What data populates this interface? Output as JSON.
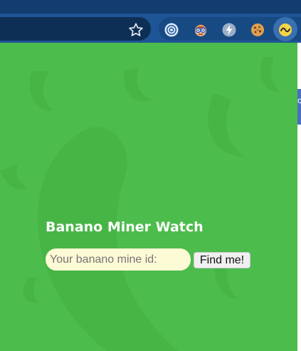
{
  "browser": {
    "star_icon": "star-outline-icon",
    "extensions": [
      {
        "name": "radar-icon"
      },
      {
        "name": "nerd-face-icon"
      },
      {
        "name": "bolt-icon"
      },
      {
        "name": "cookie-icon"
      },
      {
        "name": "banano-icon"
      }
    ],
    "colors": {
      "toolbar": "#1e5596",
      "tabstrip": "#123d6e",
      "omnibox": "#0e2f55"
    }
  },
  "page": {
    "title": "Banano Miner Watch",
    "background_color": "#4cbc4c",
    "search": {
      "placeholder": "Your banano mine id:",
      "value": "",
      "button_label": "Find me!"
    }
  },
  "side_strip": {
    "char": "c"
  }
}
